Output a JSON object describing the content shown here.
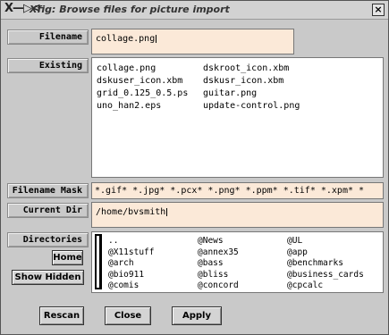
{
  "window": {
    "title": "Xfig: Browse files for picture import",
    "logo": "X—▷⊲",
    "close_glyph": "×"
  },
  "filename": {
    "label": "Filename",
    "value": "collage.png"
  },
  "existing": {
    "label": "Existing",
    "files": [
      "collage.png",
      "dskroot_icon.xbm",
      "dskuser_icon.xbm",
      "dskusr_icon.xbm",
      "grid_0.125_0.5.ps",
      "guitar.png",
      "uno_han2.eps",
      "update-control.png"
    ]
  },
  "filename_mask": {
    "label": "Filename Mask",
    "value": "*.gif* *.jpg* *.pcx* *.png* *.ppm* *.tif* *.xpm* *"
  },
  "current_dir": {
    "label": "Current Dir",
    "value": "/home/bvsmith"
  },
  "directories": {
    "label": "Directories",
    "home_button": "Home",
    "show_hidden_button": "Show Hidden",
    "items": [
      "..",
      "@News",
      "@UL",
      "@X11stuff",
      "@annex35",
      "@app",
      "@arch",
      "@bass",
      "@benchmarks",
      "@bio911",
      "@bliss",
      "@business_cards",
      "@comis",
      "@concord",
      "@cpcalc"
    ]
  },
  "buttons": {
    "rescan": "Rescan",
    "close": "Close",
    "apply": "Apply"
  }
}
